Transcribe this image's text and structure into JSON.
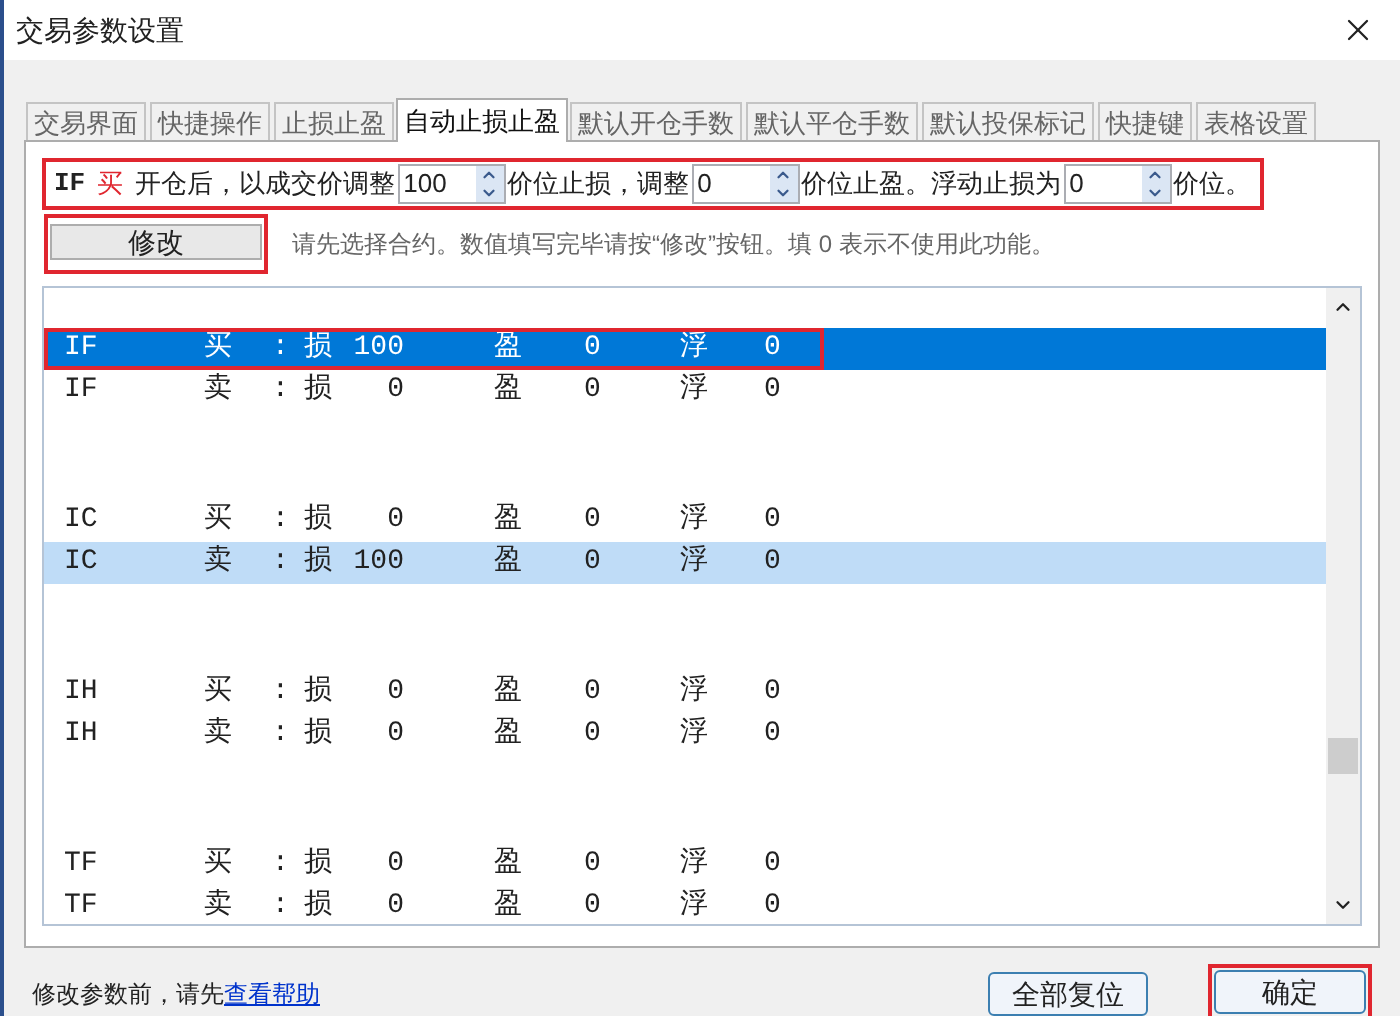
{
  "window": {
    "title": "交易参数设置"
  },
  "tabs": [
    {
      "label": "交易界面",
      "selected": false
    },
    {
      "label": "快捷操作",
      "selected": false
    },
    {
      "label": "止损止盈",
      "selected": false
    },
    {
      "label": "自动止损止盈",
      "selected": true
    },
    {
      "label": "默认开仓手数",
      "selected": false
    },
    {
      "label": "默认平仓手数",
      "selected": false
    },
    {
      "label": "默认投保标记",
      "selected": false
    },
    {
      "label": "快捷键",
      "selected": false
    },
    {
      "label": "表格设置",
      "selected": false
    }
  ],
  "stop_settings": {
    "highlighted": true,
    "contract": "IF",
    "side": "买",
    "segments": [
      {
        "kind": "text",
        "text": "开仓后，以成交价调整"
      },
      {
        "kind": "spin",
        "value": "100"
      },
      {
        "kind": "text",
        "text": "价位止损，调整"
      },
      {
        "kind": "spin",
        "value": "0"
      },
      {
        "kind": "text",
        "text": "价位止盈。浮动止损为"
      },
      {
        "kind": "spin",
        "value": "0"
      },
      {
        "kind": "text",
        "text": "价位。"
      }
    ]
  },
  "modify_button": {
    "label": "修改",
    "highlighted": true
  },
  "hint": "请先选择合约。数值填写完毕请按“修改”按钮。填 0 表示不使用此功能。",
  "list": {
    "groups": [
      {
        "rows": [
          {
            "code": "IF",
            "side": "买",
            "colon": ":",
            "loss_label": "损",
            "loss": "100",
            "profit_label": "盈",
            "profit": "0",
            "float_label": "浮",
            "float": "0",
            "selected": true,
            "hovered": false,
            "highlighted": true
          },
          {
            "code": "IF",
            "side": "卖",
            "colon": ":",
            "loss_label": "损",
            "loss": "0",
            "profit_label": "盈",
            "profit": "0",
            "float_label": "浮",
            "float": "0",
            "selected": false,
            "hovered": false,
            "highlighted": false
          }
        ]
      },
      {
        "rows": [
          {
            "code": "IC",
            "side": "买",
            "colon": ":",
            "loss_label": "损",
            "loss": "0",
            "profit_label": "盈",
            "profit": "0",
            "float_label": "浮",
            "float": "0",
            "selected": false,
            "hovered": false,
            "highlighted": false
          },
          {
            "code": "IC",
            "side": "卖",
            "colon": ":",
            "loss_label": "损",
            "loss": "100",
            "profit_label": "盈",
            "profit": "0",
            "float_label": "浮",
            "float": "0",
            "selected": false,
            "hovered": true,
            "highlighted": false
          }
        ]
      },
      {
        "rows": [
          {
            "code": "IH",
            "side": "买",
            "colon": ":",
            "loss_label": "损",
            "loss": "0",
            "profit_label": "盈",
            "profit": "0",
            "float_label": "浮",
            "float": "0",
            "selected": false,
            "hovered": false,
            "highlighted": false
          },
          {
            "code": "IH",
            "side": "卖",
            "colon": ":",
            "loss_label": "损",
            "loss": "0",
            "profit_label": "盈",
            "profit": "0",
            "float_label": "浮",
            "float": "0",
            "selected": false,
            "hovered": false,
            "highlighted": false
          }
        ]
      },
      {
        "rows": [
          {
            "code": "TF",
            "side": "买",
            "colon": ":",
            "loss_label": "损",
            "loss": "0",
            "profit_label": "盈",
            "profit": "0",
            "float_label": "浮",
            "float": "0",
            "selected": false,
            "hovered": false,
            "highlighted": false
          },
          {
            "code": "TF",
            "side": "卖",
            "colon": ":",
            "loss_label": "损",
            "loss": "0",
            "profit_label": "盈",
            "profit": "0",
            "float_label": "浮",
            "float": "0",
            "selected": false,
            "hovered": false,
            "highlighted": false
          }
        ]
      }
    ]
  },
  "footer": {
    "text": "修改参数前，请先",
    "link": "查看帮助",
    "reset_button": "全部复位",
    "ok_button": "确定",
    "ok_highlighted": true
  }
}
